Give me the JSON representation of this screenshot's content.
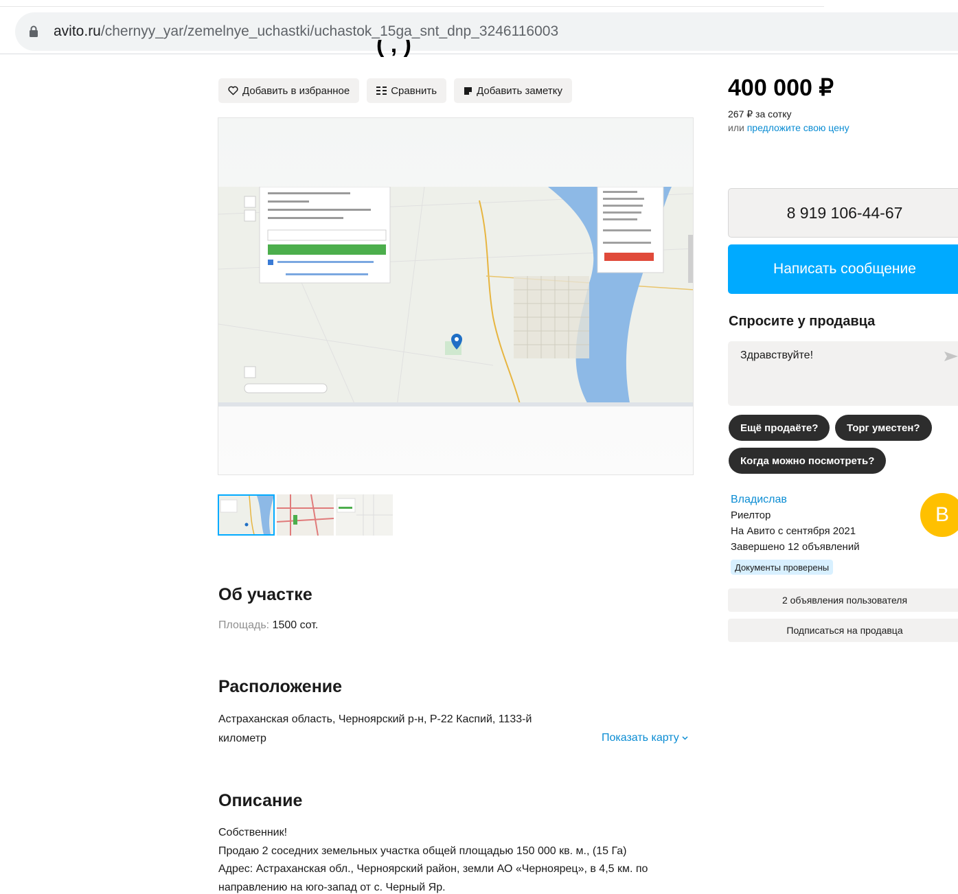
{
  "browser": {
    "url_host": "avito.ru",
    "url_path": "/chernyy_yar/zemelnye_uchastki/uchastok_15ga_snt_dnp_3246116003"
  },
  "title_fragment": "( ,  )",
  "actions": {
    "favorite": "Добавить в избранное",
    "compare": "Сравнить",
    "note": "Добавить заметку"
  },
  "about": {
    "heading": "Об участке",
    "area_label": "Площадь:",
    "area_value": "1500 сот."
  },
  "location": {
    "heading": "Расположение",
    "address": "Астраханская область, Черноярский р-н, Р-22 Каспий, 1133-й километр",
    "show_map": "Показать карту"
  },
  "description": {
    "heading": "Описание",
    "lines": [
      "Собственник!",
      "Продаю 2 соседних земельных участка общей площадью 150 000 кв. м., (15 Га)",
      "Адрес: Астраханская обл., Черноярский район, земли АО «Черноярец», в 4,5 км. по",
      "направлению на юго-запад от с. Черный Яр."
    ]
  },
  "price": {
    "value": "400 000 ₽",
    "per_unit": "267 ₽ за сотку",
    "offer_prefix": "или",
    "offer_link": "предложите свою цену"
  },
  "contact": {
    "phone": "8 919 106-44-67",
    "message_button": "Написать сообщение"
  },
  "ask": {
    "heading": "Спросите у продавца",
    "placeholder": "Здравствуйте!",
    "chips": [
      "Ещё продаёте?",
      "Торг уместен?",
      "Когда можно посмотреть?"
    ]
  },
  "seller": {
    "name": "Владислав",
    "role": "Риелтор",
    "since": "На Авито с сентября 2021",
    "completed": "Завершено 12 объявлений",
    "badge": "Документы проверены",
    "avatar_letter": "В",
    "ads_button": "2 объявления пользователя",
    "subscribe_button": "Подписаться на продавца"
  },
  "colors": {
    "accent_blue": "#00aaff",
    "link_blue": "#0a8cd3",
    "avatar_yellow": "#ffc000",
    "chip_dark": "#2d2d2d"
  }
}
